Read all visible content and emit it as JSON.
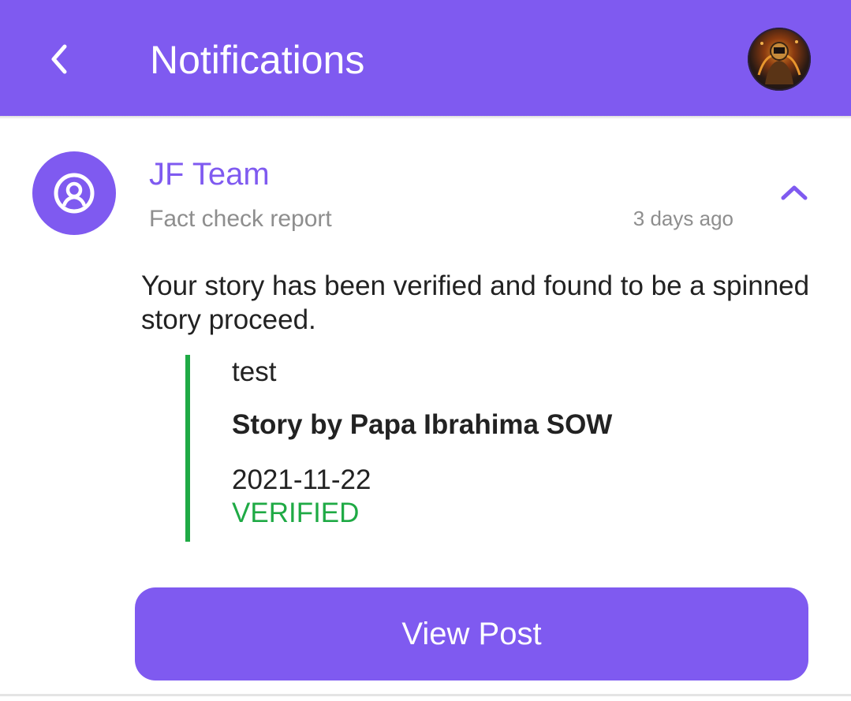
{
  "header": {
    "title": "Notifications",
    "back_icon": "chevron-left-icon",
    "avatar_icon": "user-avatar",
    "background": "#7f5af0"
  },
  "notification": {
    "sender": "JF Team",
    "sender_icon": "team-user-icon",
    "subject": "Fact check report",
    "time": "3 days ago",
    "toggle_icon": "chevron-up-icon",
    "message": "Your story has been verified and found to be a spinned story proceed.",
    "story": {
      "title": "test",
      "author": "Story by Papa Ibrahima SOW",
      "date": "2021-11-22",
      "status": "VERIFIED",
      "status_color": "#1faa45"
    },
    "action_label": "View Post"
  }
}
